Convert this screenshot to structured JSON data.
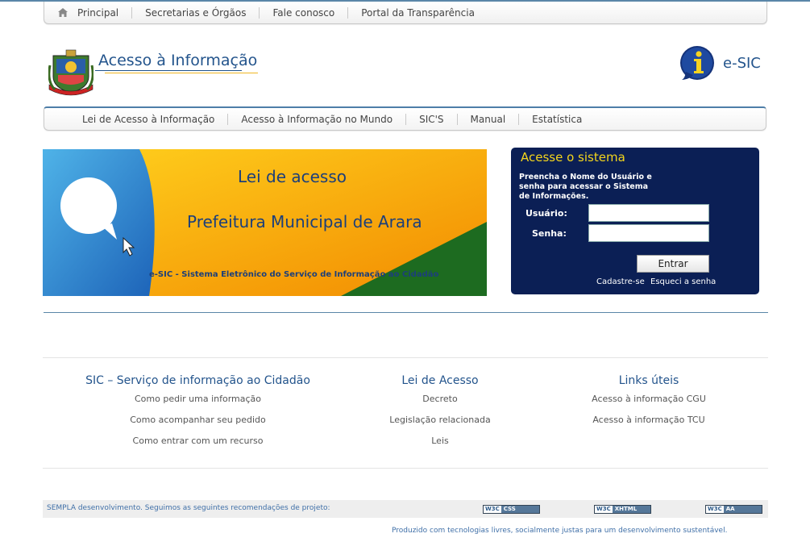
{
  "topnav": {
    "items": [
      "Principal",
      "Secretarias e Órgãos",
      "Fale conosco",
      "Portal da Transparência"
    ]
  },
  "header": {
    "brand": "Acesso à Informação",
    "esic": "e-SIC"
  },
  "subnav": {
    "items": [
      "Lei de Acesso à Informação",
      "Acesso à Informação no Mundo",
      "SIC'S",
      "Manual",
      "Estatística"
    ]
  },
  "banner": {
    "title": "Lei de acesso",
    "subtitle": "Prefeitura Municipal de Arara",
    "footer": "e-SIC - Sistema Eletrônico do Serviço de Informação ao Cidadão"
  },
  "login": {
    "title": "Acesse o sistema",
    "hint": "Preencha o Nome do Usuário e senha para acessar o Sistema de Informações.",
    "user_label": "Usuário:",
    "password_label": "Senha:",
    "user_value": "",
    "password_value": "",
    "submit_label": "Entrar",
    "register_link": "Cadastre-se",
    "forgot_link": "Esqueci a senha"
  },
  "footer": {
    "columns": [
      {
        "title": "SIC – Serviço de informação ao Cidadão",
        "links": [
          "Como pedir uma informação",
          "Como acompanhar seu pedido",
          "Como entrar com um recurso"
        ]
      },
      {
        "title": "Lei de Acesso",
        "links": [
          "Decreto",
          "Legislação relacionada",
          "Leis"
        ]
      },
      {
        "title": "Links úteis",
        "links": [
          "Acesso à informação CGU",
          "Acesso à informação TCU"
        ]
      }
    ],
    "credits": "SEMPLA desenvolvimento. Seguimos as seguintes recomendações de projeto:",
    "badges": [
      {
        "a": "W3C",
        "b": "CSS"
      },
      {
        "a": "W3C",
        "b": "XHTML"
      },
      {
        "a": "W3C",
        "b": "AA"
      }
    ],
    "produced": "Produzido com tecnologias livres, socialmente justas para um desenvolvimento sustentável."
  }
}
